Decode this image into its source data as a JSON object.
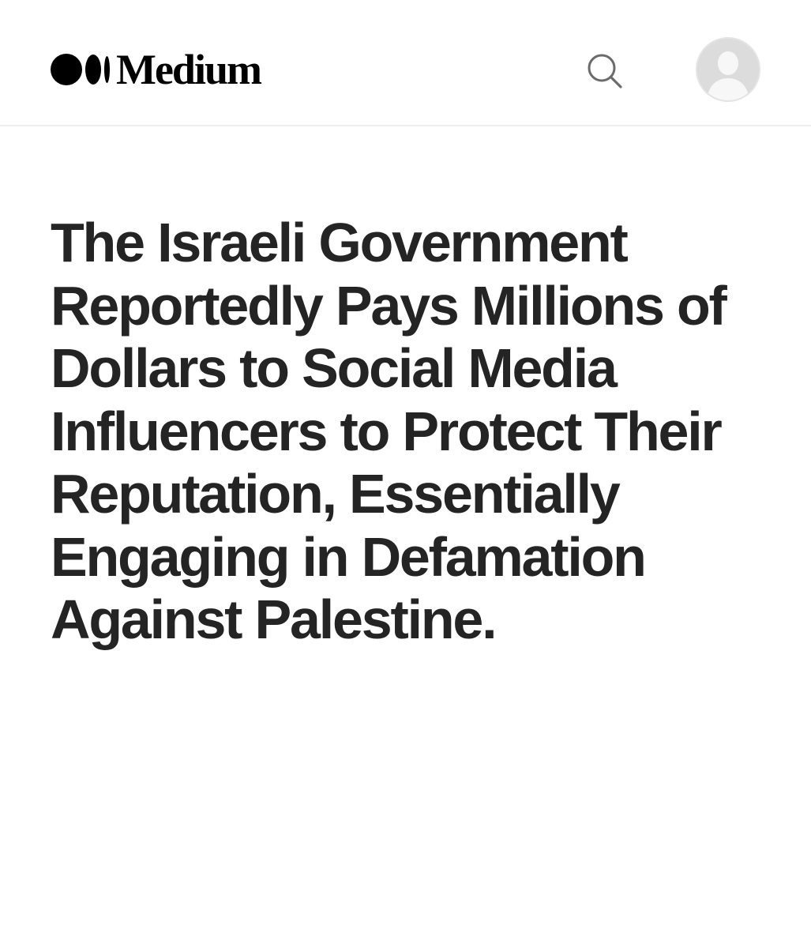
{
  "header": {
    "logo_text": "Medium",
    "search_icon": "search-icon",
    "avatar_icon": "user-avatar-icon"
  },
  "article": {
    "title": "The Israeli Government Reportedly Pays Millions of Dollars to Social Media Influencers to Protect Their Reputation, Essentially Engaging in Defamation Against Palestine."
  },
  "colors": {
    "text": "#242424",
    "divider": "#f0f0f0",
    "avatar_bg": "#dcdcdc"
  }
}
